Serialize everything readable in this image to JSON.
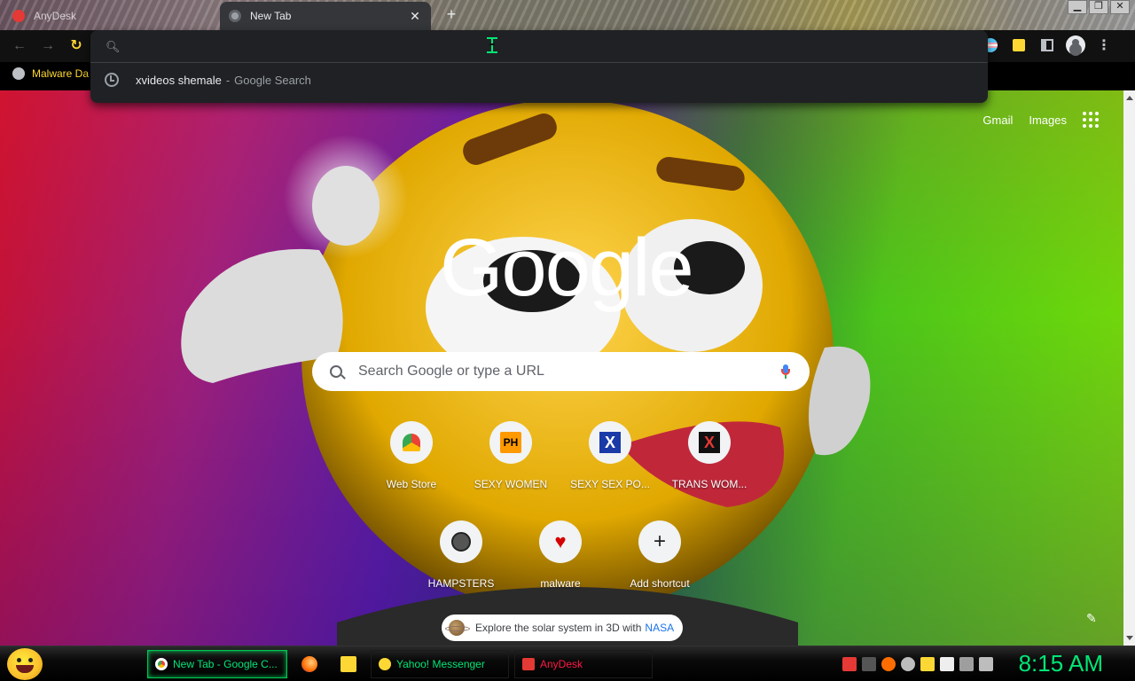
{
  "tabs": [
    {
      "title": "AnyDesk",
      "active": false
    },
    {
      "title": "New Tab",
      "active": true
    }
  ],
  "omnibox": {
    "value": "",
    "suggestion": {
      "query": "xvideos shemale",
      "separator": "-",
      "source": "Google Search"
    }
  },
  "bookmarks": [
    {
      "label": "Malware Da"
    }
  ],
  "ntp": {
    "top_links": {
      "gmail": "Gmail",
      "images": "Images"
    },
    "logo": "Google",
    "search_placeholder": "Search Google or type a URL",
    "shortcuts": [
      {
        "label": "Web Store",
        "icon": "webstore-icon"
      },
      {
        "label": "SEXY WOMEN",
        "icon": "PH"
      },
      {
        "label": "SEXY SEX PO...",
        "icon": "X"
      },
      {
        "label": "TRANS WOM...",
        "icon": "X"
      },
      {
        "label": "HAMPSTERS",
        "icon": "hamster-icon"
      },
      {
        "label": "malware",
        "icon": "heart-icon"
      },
      {
        "label": "Add shortcut",
        "icon": "+"
      }
    ],
    "promo": {
      "text": "Explore the solar system in 3D with",
      "link": "NASA"
    }
  },
  "taskbar": {
    "tasks": [
      {
        "label": "New Tab - Google C..."
      },
      {
        "label": "Yahoo! Messenger"
      },
      {
        "label": "AnyDesk"
      }
    ],
    "clock": "8:15 AM"
  },
  "colors": {
    "accent_green": "#00e676",
    "bookmark_yellow": "#fdd835",
    "taskbar_red": "#ff1744"
  }
}
